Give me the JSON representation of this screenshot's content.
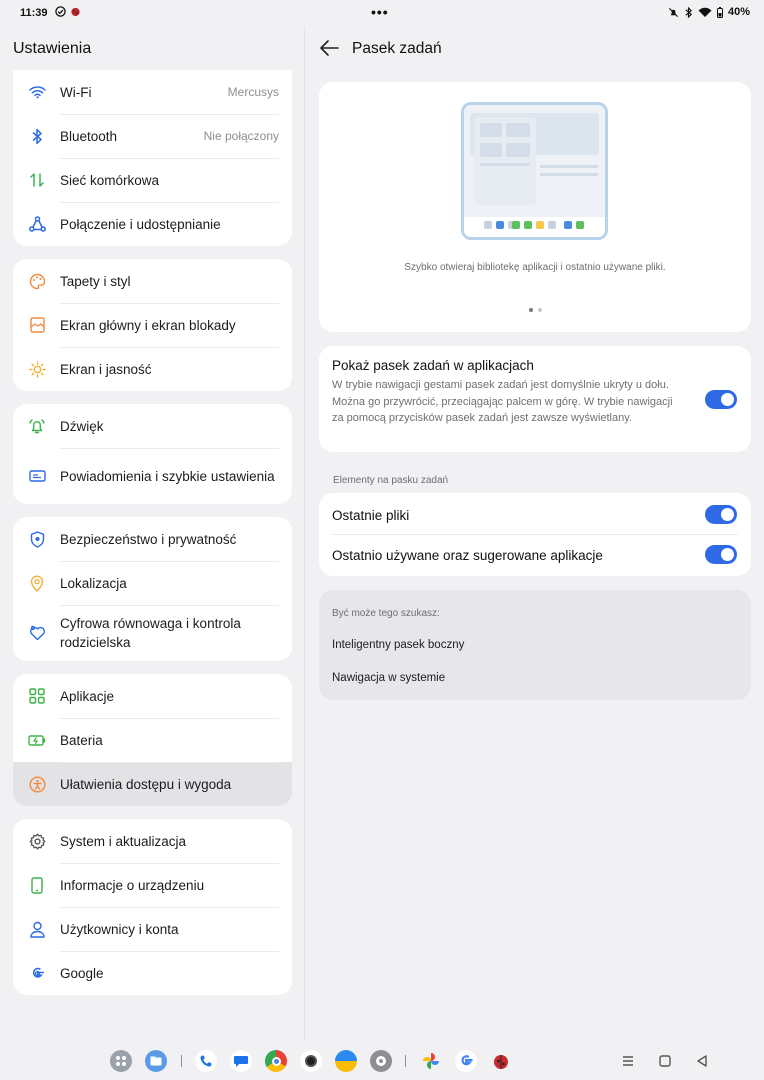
{
  "status_bar": {
    "time": "11:39",
    "battery": "40%"
  },
  "left": {
    "title": "Ustawienia",
    "groups": [
      [
        {
          "name": "wifi",
          "label": "Wi-Fi",
          "value": "Mercusys",
          "icon": "wifi-icon"
        },
        {
          "name": "bluetooth",
          "label": "Bluetooth",
          "value": "Nie połączony",
          "icon": "bluetooth-icon"
        },
        {
          "name": "mobile",
          "label": "Sieć komórkowa",
          "value": "",
          "icon": "mobile-data-icon"
        },
        {
          "name": "connection",
          "label": "Połączenie i udostępnianie",
          "value": "",
          "icon": "share-icon"
        }
      ],
      [
        {
          "name": "wallpaper",
          "label": "Tapety i styl",
          "value": "",
          "icon": "palette-icon"
        },
        {
          "name": "home-lock",
          "label": "Ekran główny i ekran blokady",
          "value": "",
          "icon": "home-screen-icon"
        },
        {
          "name": "display",
          "label": "Ekran i jasność",
          "value": "",
          "icon": "brightness-icon"
        }
      ],
      [
        {
          "name": "sound",
          "label": "Dźwięk",
          "value": "",
          "icon": "bell-icon"
        },
        {
          "name": "notifications",
          "label": "Powiadomienia i szybkie ustawienia",
          "value": "",
          "icon": "notification-icon"
        }
      ],
      [
        {
          "name": "security",
          "label": "Bezpieczeństwo i prywatność",
          "value": "",
          "icon": "shield-icon"
        },
        {
          "name": "location",
          "label": "Lokalizacja",
          "value": "",
          "icon": "location-icon"
        },
        {
          "name": "wellbeing",
          "label": "Cyfrowa równowaga i kontrola rodzicielska",
          "value": "",
          "icon": "heart-icon"
        }
      ],
      [
        {
          "name": "apps",
          "label": "Aplikacje",
          "value": "",
          "icon": "apps-grid-icon"
        },
        {
          "name": "battery",
          "label": "Bateria",
          "value": "",
          "icon": "battery-icon"
        },
        {
          "name": "accessibility",
          "label": "Ułatwienia dostępu i wygoda",
          "value": "",
          "icon": "accessibility-icon"
        }
      ],
      [
        {
          "name": "system",
          "label": "System i aktualizacja",
          "value": "",
          "icon": "gear-icon"
        },
        {
          "name": "about",
          "label": "Informacje o urządzeniu",
          "value": "",
          "icon": "phone-icon"
        },
        {
          "name": "users",
          "label": "Użytkownicy i konta",
          "value": "",
          "icon": "user-icon"
        },
        {
          "name": "google",
          "label": "Google",
          "value": "",
          "icon": "google-icon"
        }
      ]
    ]
  },
  "right": {
    "title": "Pasek zadań",
    "illustration_caption": "Szybko otwieraj bibliotekę aplikacji i ostatnio używane pliki.",
    "show_taskbar": {
      "title": "Pokaż pasek zadań w aplikacjach",
      "description": "W trybie nawigacji gestami pasek zadań jest domyślnie ukryty u dołu. Można go przywrócić, przeciągając palcem w górę. W trybie nawigacji za pomocą przycisków pasek zadań jest zawsze wyświetlany.",
      "enabled": true
    },
    "section_label": "Elementy na pasku zadań",
    "elements": [
      {
        "label": "Ostatnie pliki",
        "enabled": true
      },
      {
        "label": "Ostatnio używane oraz sugerowane aplikacje",
        "enabled": true
      }
    ],
    "suggestions": {
      "label": "Być może tego szukasz:",
      "links": [
        "Inteligentny pasek boczny",
        "Nawigacja w systemie"
      ]
    }
  },
  "dock": {
    "apps": [
      "app-library-icon",
      "files-icon",
      "phone-app-icon",
      "messages-icon",
      "chrome-icon",
      "camera-icon",
      "weather-icon",
      "settings-icon",
      "photos-icon",
      "google-app-icon",
      "ladybug-app-icon"
    ]
  }
}
